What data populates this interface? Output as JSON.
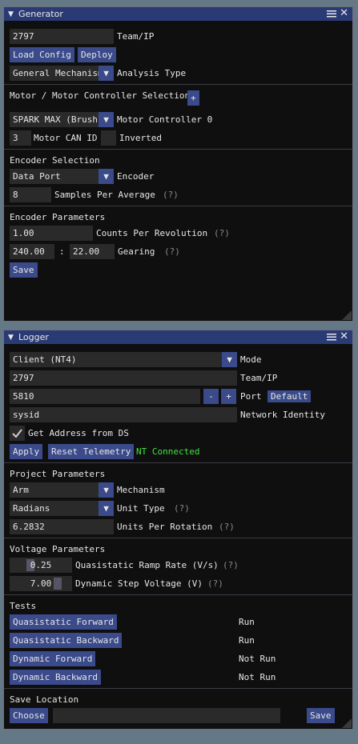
{
  "generator": {
    "title": "Generator",
    "team_value": "2797",
    "team_label": "Team/IP",
    "load_config": "Load Config",
    "deploy": "Deploy",
    "analysis_value": "General Mechanism",
    "analysis_label": "Analysis Type",
    "motor_section": "Motor / Motor Controller Selection",
    "add_label": "+",
    "motor_value": "SPARK MAX (Brushl",
    "motor_label": "Motor Controller 0",
    "can_value": "3",
    "can_label": "Motor CAN ID",
    "inverted_label": "Inverted",
    "encoder_section": "Encoder Selection",
    "encoder_value": "Data Port",
    "encoder_label": "Encoder",
    "samples_value": "8",
    "samples_label": "Samples Per Average",
    "help": "(?)",
    "encparams_section": "Encoder Parameters",
    "cpr_value": "1.00",
    "cpr_label": "Counts Per Revolution",
    "gear_a": "240.00",
    "colon": ":",
    "gear_b": "22.00",
    "gearing_label": "Gearing",
    "save": "Save"
  },
  "logger": {
    "title": "Logger",
    "mode_value": "Client (NT4)",
    "mode_label": "Mode",
    "team_value": "2797",
    "team_label": "Team/IP",
    "port_value": "5810",
    "minus": "-",
    "plus": "+",
    "port_label": "Port",
    "default_label": "Default",
    "netid_value": "sysid",
    "netid_label": "Network Identity",
    "getaddr_label": "Get Address from DS",
    "apply": "Apply",
    "reset_telemetry": "Reset Telemetry",
    "nt_status": "NT Connected",
    "project_section": "Project Parameters",
    "mechanism_value": "Arm",
    "mechanism_label": "Mechanism",
    "unit_value": "Radians",
    "unit_label": "Unit Type",
    "help": "(?)",
    "upr_value": "6.2832",
    "upr_label": "Units Per Rotation",
    "voltage_section": "Voltage Parameters",
    "ramp_value": "0.25",
    "ramp_label": "Quasistatic Ramp Rate (V/s)",
    "step_value": "7.00",
    "step_label": "Dynamic Step Voltage (V)",
    "tests_section": "Tests",
    "tests": [
      {
        "name": "Quasistatic Forward",
        "status": "Run"
      },
      {
        "name": "Quasistatic Backward",
        "status": "Run"
      },
      {
        "name": "Dynamic Forward",
        "status": "Not Run"
      },
      {
        "name": "Dynamic Backward",
        "status": "Not Run"
      }
    ],
    "saveloc_section": "Save Location",
    "choose": "Choose",
    "path_value": "",
    "save": "Save"
  },
  "colors": {
    "background": "#647985",
    "titlebar": "#2a3a74",
    "button": "#3a4a8a",
    "field": "#2a2a2a",
    "status_green": "#3ee63e"
  },
  "icons": [
    "collapse-triangle-icon",
    "window-menu-icon",
    "close-icon",
    "chevron-down-icon",
    "checkmark-icon",
    "resize-grip-icon"
  ]
}
